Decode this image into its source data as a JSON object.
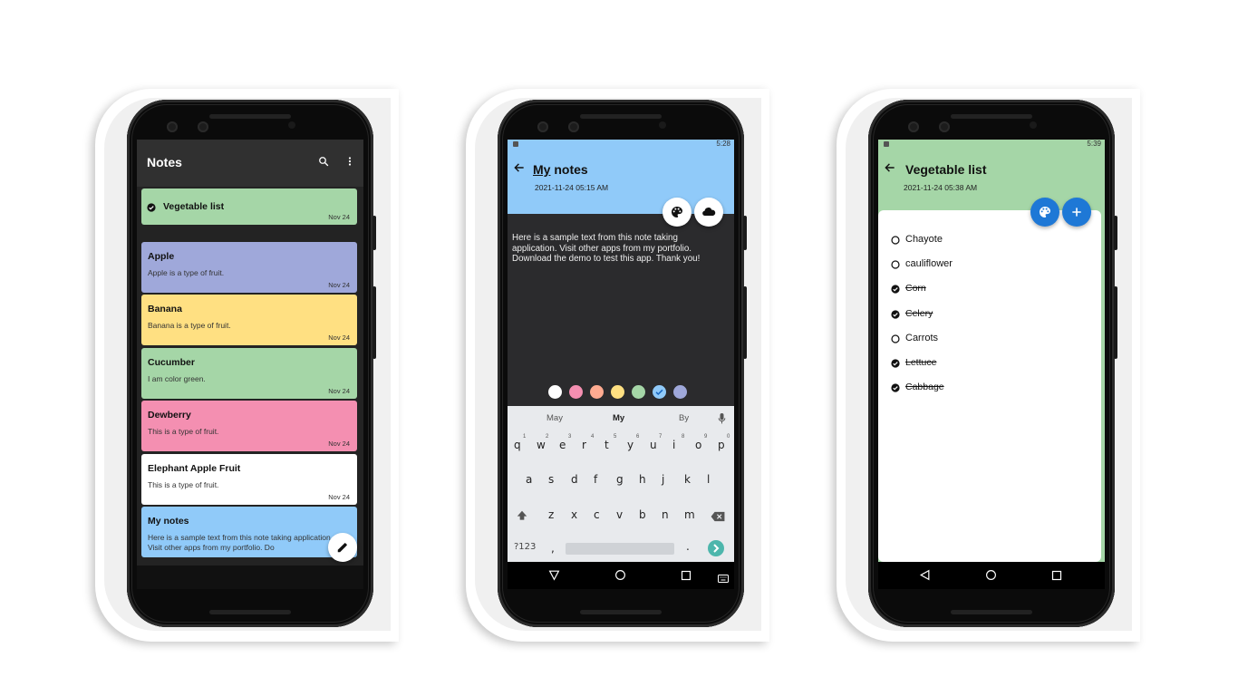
{
  "phone1": {
    "app_title": "Notes",
    "notes": [
      {
        "title": "Vegetable list",
        "body": "",
        "date": "Nov 24",
        "color": "#a5d6a7",
        "checked": true
      },
      {
        "title": "Apple",
        "body": "Apple is a type of fruit.",
        "date": "Nov 24",
        "color": "#9fa8da",
        "checked": false
      },
      {
        "title": "Banana",
        "body": "Banana is a type of fruit.",
        "date": "Nov 24",
        "color": "#ffe082",
        "checked": false
      },
      {
        "title": "Cucumber",
        "body": "I am color green.",
        "date": "Nov 24",
        "color": "#a5d6a7",
        "checked": false
      },
      {
        "title": "Dewberry",
        "body": "This is a type of fruit.",
        "date": "Nov 24",
        "color": "#f48fb1",
        "checked": false
      },
      {
        "title": "Elephant Apple Fruit",
        "body": "This is a type of fruit.",
        "date": "Nov 24",
        "color": "#ffffff",
        "checked": false
      },
      {
        "title": "My notes",
        "body": "Here is a sample text from this note taking application. Visit other apps from my portfolio. Do",
        "date": "",
        "color": "#90caf9",
        "checked": false
      }
    ],
    "icons": {
      "search": "search-icon",
      "more": "more-vert-icon",
      "fab": "edit-pencil-icon"
    }
  },
  "phone2": {
    "status_time": "5:28",
    "title_underlined": "My",
    "title_rest": " notes",
    "date": "2021-11-24 05:15 AM",
    "body": "Here is a sample text from this note taking application. Visit other apps from my portfolio. Download the demo to test this app. Thank you!",
    "swatches": [
      "#ffffff",
      "#f48fb1",
      "#ffab91",
      "#ffe082",
      "#a5d6a7",
      "#90caf9",
      "#9fa8da"
    ],
    "selected_swatch": "#90caf9",
    "suggestions": [
      "May",
      "My",
      "By"
    ],
    "rows": {
      "row1": [
        "q",
        "w",
        "e",
        "r",
        "t",
        "y",
        "u",
        "i",
        "o",
        "p"
      ],
      "row1_hints": [
        "1",
        "2",
        "3",
        "4",
        "5",
        "6",
        "7",
        "8",
        "9",
        "0"
      ],
      "row2": [
        "a",
        "s",
        "d",
        "f",
        "g",
        "h",
        "j",
        "k",
        "l"
      ],
      "row3": [
        "z",
        "x",
        "c",
        "v",
        "b",
        "n",
        "m"
      ]
    },
    "symbols_key": "?123",
    "comma_key": ",",
    "period_key": "."
  },
  "phone3": {
    "status_time": "5:39",
    "title": "Vegetable list",
    "date": "2021-11-24 05:38 AM",
    "items": [
      {
        "text": "Chayote",
        "done": false
      },
      {
        "text": "cauliflower",
        "done": false
      },
      {
        "text": "Corn",
        "done": true
      },
      {
        "text": "Celery",
        "done": true
      },
      {
        "text": "Carrots",
        "done": false
      },
      {
        "text": "Lettuce",
        "done": true
      },
      {
        "text": "Cabbage",
        "done": true
      }
    ]
  }
}
